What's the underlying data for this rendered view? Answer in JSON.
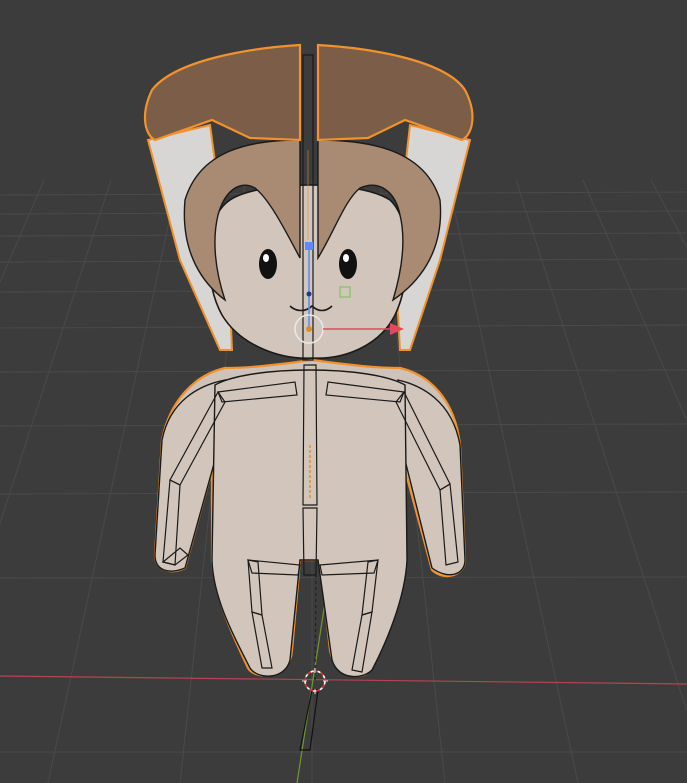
{
  "viewport": {
    "name": "3D Viewport",
    "background_color": "#3c3c3c",
    "grid_color": "#4a4a4a",
    "x_axis_color": "#b5454f",
    "y_axis_color": "#6e9a2c"
  },
  "scene": {
    "active_object": "character-mesh",
    "selection_outline_color": "#f0922e",
    "armature_wire_color": "#1a1a1a",
    "skin_color": "#d2c6bc",
    "hair_dark_color": "#7c5e48",
    "hair_light_color": "#a98a73",
    "ear_inner_color": "#d8d6d4",
    "gizmo": {
      "x_arrow_color": "#e14a5a",
      "y_handle_color": "#5a8cff",
      "z_handle_color": "#8cc46c",
      "pivot_color": "#e08a2a"
    },
    "cursor_3d": "3d-cursor-icon"
  }
}
